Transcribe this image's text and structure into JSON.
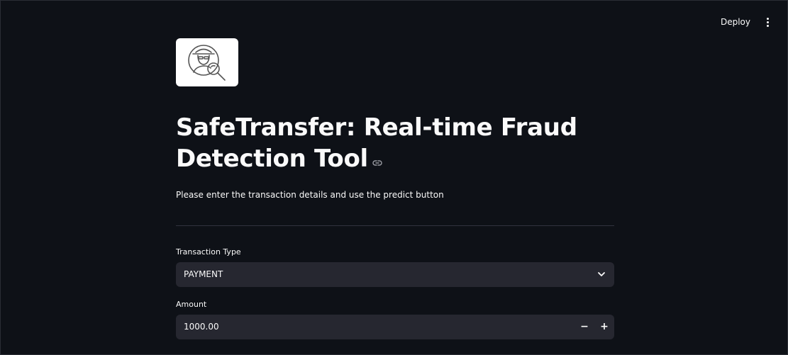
{
  "header": {
    "deploy_label": "Deploy"
  },
  "main": {
    "title": "SafeTransfer: Real-time Fraud Detection Tool",
    "subtitle": "Please enter the transaction details and use the predict button"
  },
  "form": {
    "transaction_type": {
      "label": "Transaction Type",
      "value": "PAYMENT"
    },
    "amount": {
      "label": "Amount",
      "value": "1000.00",
      "minus_label": "−",
      "plus_label": "+"
    }
  },
  "icons": {
    "logo": "fraud-detective-magnifier-icon",
    "menu": "kebab-menu-icon",
    "link": "link-icon",
    "dropdown": "chevron-down-icon"
  },
  "colors": {
    "background": "#0e1117",
    "input_background": "#262730",
    "text": "#fafafa",
    "divider": "#31333f"
  }
}
